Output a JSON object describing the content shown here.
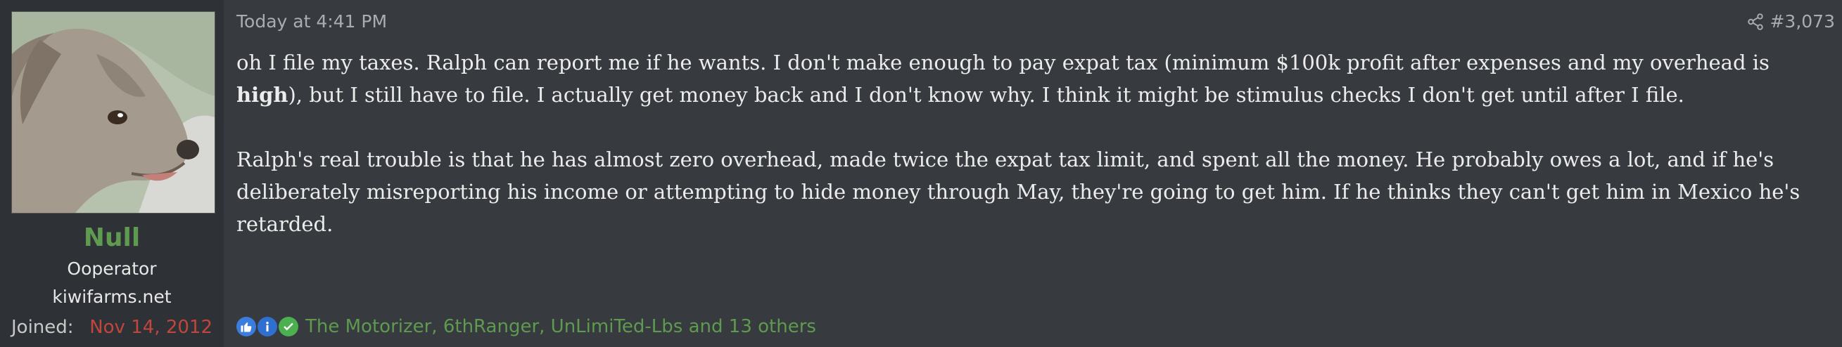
{
  "user": {
    "name": "Null",
    "title": "Ooperator",
    "site": "kiwifarms.net",
    "joined_label": "Joined:",
    "joined_date": "Nov 14, 2012",
    "avatar_icon": "dog-avatar"
  },
  "post": {
    "timestamp": "Today at 4:41 PM",
    "number": "#3,073",
    "share_icon": "share-icon",
    "paragraph1_a": "oh I file my taxes. Ralph can report me if he wants. I don't make enough to pay expat tax (minimum $100k profit after expenses and my overhead is ",
    "paragraph1_bold": "high",
    "paragraph1_b": "), but I still have to file. I actually get money back and I don't know why. I think it might be stimulus checks I don't get until after I file.",
    "paragraph2": "Ralph's real trouble is that he has almost zero overhead, made twice the expat tax limit, and spent all the money. He probably owes a lot, and if he's deliberately misreporting his income or attempting to hide money through May, they're going to get him. If he thinks they can't get him in Mexico he's retarded."
  },
  "reactions": {
    "icons": [
      "thumbs-up-icon",
      "informative-icon",
      "check-icon"
    ],
    "text": "The Motorizer, 6thRanger, UnLimiTed-Lbs and 13 others"
  },
  "colors": {
    "username": "#5e9a4f",
    "joined_date": "#c0463e",
    "background": "#373a3e",
    "sidebar": "#2e3135"
  }
}
